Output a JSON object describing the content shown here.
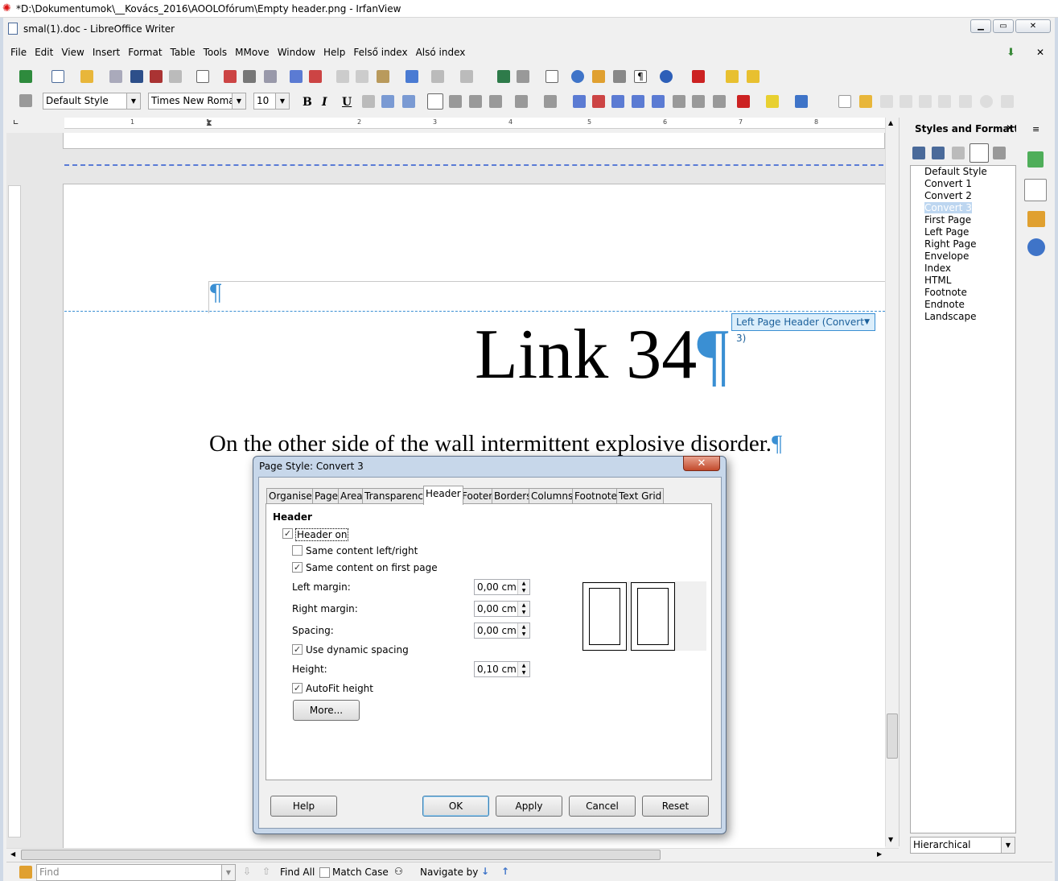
{
  "irfanview": {
    "title": "*D:\\Dokumentumok\\__Kovács_2016\\AOOLOfórum\\Empty header.png - IrfanView"
  },
  "writer": {
    "title": "smal(1).doc - LibreOffice Writer"
  },
  "menu": [
    "File",
    "Edit",
    "View",
    "Insert",
    "Format",
    "Table",
    "Tools",
    "MMove",
    "Window",
    "Help",
    "Felső index",
    "Alsó index"
  ],
  "format_toolbar": {
    "paragraph_style": "Default Style",
    "font_name": "Times New Roman",
    "font_size": "10"
  },
  "ruler": {
    "marks": [
      "1",
      "1",
      "2",
      "3",
      "4",
      "5",
      "6",
      "7",
      "8"
    ]
  },
  "document": {
    "header_label": "Left Page Header (Convert 3)",
    "heading": "Link 34",
    "paragraph": "On the other side of the wall intermittent explosive disorder.",
    "pilcrow": "¶"
  },
  "sidebar": {
    "title": "Styles and Formatting",
    "styles": [
      "Default Style",
      "Convert 1",
      "Convert 2",
      "Convert 3",
      "First Page",
      "Left Page",
      "Right Page",
      "Envelope",
      "Index",
      "HTML",
      "Footnote",
      "Endnote",
      "Landscape"
    ],
    "selected": "Convert 3",
    "filter": "Hierarchical"
  },
  "findbar": {
    "placeholder": "Find",
    "find_all": "Find All",
    "match_case": "Match Case",
    "navigate_by": "Navigate by"
  },
  "dialog": {
    "title": "Page Style: Convert 3",
    "tabs": [
      "Organiser",
      "Page",
      "Area",
      "Transparency",
      "Header",
      "Footer",
      "Borders",
      "Columns",
      "Footnote",
      "Text Grid"
    ],
    "active_tab": "Header",
    "section": "Header",
    "header_on": "Header on",
    "same_lr": "Same content left/right",
    "same_first": "Same content on first page",
    "left_margin_label": "Left margin:",
    "left_margin": "0,00 cm",
    "right_margin_label": "Right margin:",
    "right_margin": "0,00 cm",
    "spacing_label": "Spacing:",
    "spacing": "0,00 cm",
    "dynamic_spacing": "Use dynamic spacing",
    "height_label": "Height:",
    "height": "0,10 cm",
    "autofit": "AutoFit height",
    "more": "More...",
    "help": "Help",
    "ok": "OK",
    "apply": "Apply",
    "cancel": "Cancel",
    "reset": "Reset",
    "close": "✕"
  },
  "colors": {
    "accent": "#3a8fd3",
    "dialog_frame": "#c7d7ea",
    "close_red": "#c24a2c"
  }
}
